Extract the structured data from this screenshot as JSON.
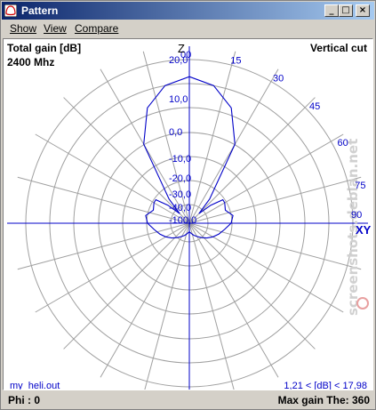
{
  "window": {
    "title": "Pattern"
  },
  "menu": {
    "show": "Show",
    "view": "View",
    "compare": "Compare"
  },
  "plot": {
    "quantity": "Total gain [dB]",
    "frequency": "2400 Mhz",
    "cut": "Vertical cut",
    "axis_z": "Z",
    "axis_xy": "XY",
    "file": "my_heli.out",
    "range": "1,21 < [dB] < 17,98",
    "watermark": "screenshots.debian.net"
  },
  "status": {
    "phi": "Phi   : 0",
    "max_gain": "Max gain The: 360"
  },
  "chart_data": {
    "type": "polar",
    "angle_labels": [
      "00",
      "15",
      "30",
      "45",
      "60",
      "75",
      "90"
    ],
    "radial_labels": [
      "20,0",
      "10,0",
      "0,0",
      "-10,0",
      "-20,0",
      "-30,0",
      "-40,0",
      "-100,0"
    ],
    "series": [
      {
        "color": "#0000c8",
        "theta": [
          0,
          10,
          20,
          30,
          40,
          45,
          50,
          55,
          60,
          70,
          80,
          90,
          100,
          110,
          120,
          130,
          140,
          150,
          160,
          170,
          180,
          190,
          200,
          210,
          220,
          230,
          240,
          250,
          260,
          270,
          280,
          290,
          300,
          305,
          310,
          315,
          320,
          330,
          340,
          350
        ],
        "gain_db": [
          18,
          17.2,
          15.2,
          11.5,
          4.5,
          2.4,
          4.1,
          5.6,
          5.6,
          5.3,
          6.0,
          5.7,
          5.0,
          4.5,
          4.0,
          3.5,
          3.0,
          2.6,
          2.3,
          2.0,
          1.8,
          2.0,
          2.3,
          2.6,
          3.0,
          3.5,
          4.0,
          4.5,
          5.0,
          5.7,
          6.0,
          5.3,
          5.6,
          5.6,
          4.1,
          2.4,
          4.5,
          11.5,
          15.2,
          17.2
        ]
      }
    ]
  }
}
